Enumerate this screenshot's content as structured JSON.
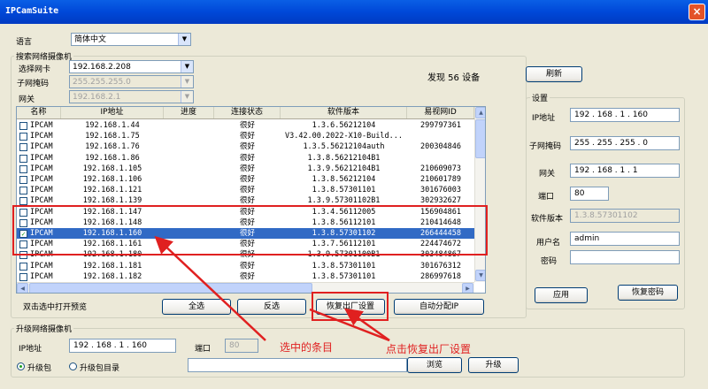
{
  "window": {
    "title": "IPCamSuite",
    "close": "×"
  },
  "language": {
    "label": "语言",
    "value": "简体中文"
  },
  "search": {
    "group_title": "搜索网络摄像机",
    "nic_label": "选择网卡",
    "nic_value": "192.168.2.208",
    "mask_label": "子网掩码",
    "mask_value": "255.255.255.0",
    "gw_label": "网关",
    "gw_value": "192.168.2.1",
    "found_text": "发现 56 设备",
    "refresh": "刷新"
  },
  "table": {
    "columns": [
      "名称",
      "IP地址",
      "进度",
      "连接状态",
      "软件版本",
      "易视网ID"
    ],
    "rows": [
      {
        "checked": false,
        "name": "IPCAM",
        "ip": "192.168.1.44",
        "progress": "",
        "status": "很好",
        "version": "1.3.6.56212104",
        "yid": "299797361",
        "selected": false
      },
      {
        "checked": false,
        "name": "IPCAM",
        "ip": "192.168.1.75",
        "progress": "",
        "status": "很好",
        "version": "V3.42.00.2022-X10-Build...",
        "yid": "",
        "selected": false
      },
      {
        "checked": false,
        "name": "IPCAM",
        "ip": "192.168.1.76",
        "progress": "",
        "status": "很好",
        "version": "1.3.5.56212104auth",
        "yid": "200304846",
        "selected": false
      },
      {
        "checked": false,
        "name": "IPCAM",
        "ip": "192.168.1.86",
        "progress": "",
        "status": "很好",
        "version": "1.3.8.56212104B1",
        "yid": "",
        "selected": false
      },
      {
        "checked": false,
        "name": "IPCAM",
        "ip": "192.168.1.105",
        "progress": "",
        "status": "很好",
        "version": "1.3.9.56212104B1",
        "yid": "210609073",
        "selected": false
      },
      {
        "checked": false,
        "name": "IPCAM",
        "ip": "192.168.1.106",
        "progress": "",
        "status": "很好",
        "version": "1.3.8.56212104",
        "yid": "210601789",
        "selected": false
      },
      {
        "checked": false,
        "name": "IPCAM",
        "ip": "192.168.1.121",
        "progress": "",
        "status": "很好",
        "version": "1.3.8.57301101",
        "yid": "301676003",
        "selected": false
      },
      {
        "checked": false,
        "name": "IPCAM",
        "ip": "192.168.1.139",
        "progress": "",
        "status": "很好",
        "version": "1.3.9.57301102B1",
        "yid": "302932627",
        "selected": false
      },
      {
        "checked": false,
        "name": "IPCAM",
        "ip": "192.168.1.147",
        "progress": "",
        "status": "很好",
        "version": "1.3.4.56112005",
        "yid": "156904861",
        "selected": false
      },
      {
        "checked": false,
        "name": "IPCAM",
        "ip": "192.168.1.148",
        "progress": "",
        "status": "很好",
        "version": "1.3.8.56112101",
        "yid": "210414648",
        "selected": false
      },
      {
        "checked": true,
        "name": "IPCAM",
        "ip": "192.168.1.160",
        "progress": "",
        "status": "很好",
        "version": "1.3.8.57301102",
        "yid": "266444458",
        "selected": true
      },
      {
        "checked": false,
        "name": "IPCAM",
        "ip": "192.168.1.161",
        "progress": "",
        "status": "很好",
        "version": "1.3.7.56112101",
        "yid": "224474672",
        "selected": false
      },
      {
        "checked": false,
        "name": "IPCAM",
        "ip": "192.168.1.180",
        "progress": "",
        "status": "很好",
        "version": "1.3.9.57301100B1",
        "yid": "303484867",
        "selected": false
      },
      {
        "checked": false,
        "name": "IPCAM",
        "ip": "192.168.1.181",
        "progress": "",
        "status": "很好",
        "version": "1.3.8.57301101",
        "yid": "301676312",
        "selected": false
      },
      {
        "checked": false,
        "name": "IPCAM",
        "ip": "192.168.1.182",
        "progress": "",
        "status": "很好",
        "version": "1.3.8.57301101",
        "yid": "286997618",
        "selected": false
      }
    ]
  },
  "bottom": {
    "dbl_click_hint": "双击选中打开预览",
    "select_all": "全选",
    "invert": "反选",
    "factory_reset": "恢复出厂设置",
    "auto_ip": "自动分配IP"
  },
  "settings": {
    "group_title": "设置",
    "ip_label": "IP地址",
    "ip_value": "192 . 168 . 1 . 160",
    "mask_label": "子网掩码",
    "mask_value": "255 . 255 . 255 . 0",
    "gw_label": "网关",
    "gw_value": "192 . 168 . 1 . 1",
    "port_label": "端口",
    "port_value": "80",
    "fw_label": "软件版本",
    "fw_value": "1.3.8.57301102",
    "user_label": "用户名",
    "user_value": "admin",
    "pwd_label": "密码",
    "pwd_value": "",
    "apply": "应用",
    "recover_pwd": "恢复密码"
  },
  "upgrade": {
    "group_title": "升级网络摄像机",
    "ip_label": "IP地址",
    "ip_value": "192 . 168 . 1 . 160",
    "port_label": "端口",
    "port_value": "80",
    "radio_pkg": "升级包",
    "radio_dir": "升级包目录",
    "path_value": "",
    "browse": "浏览",
    "upgrade": "升级"
  },
  "annotations": {
    "selected_item": "选中的条目",
    "click_reset": "点击恢复出厂设置",
    "color": "#E02020"
  }
}
